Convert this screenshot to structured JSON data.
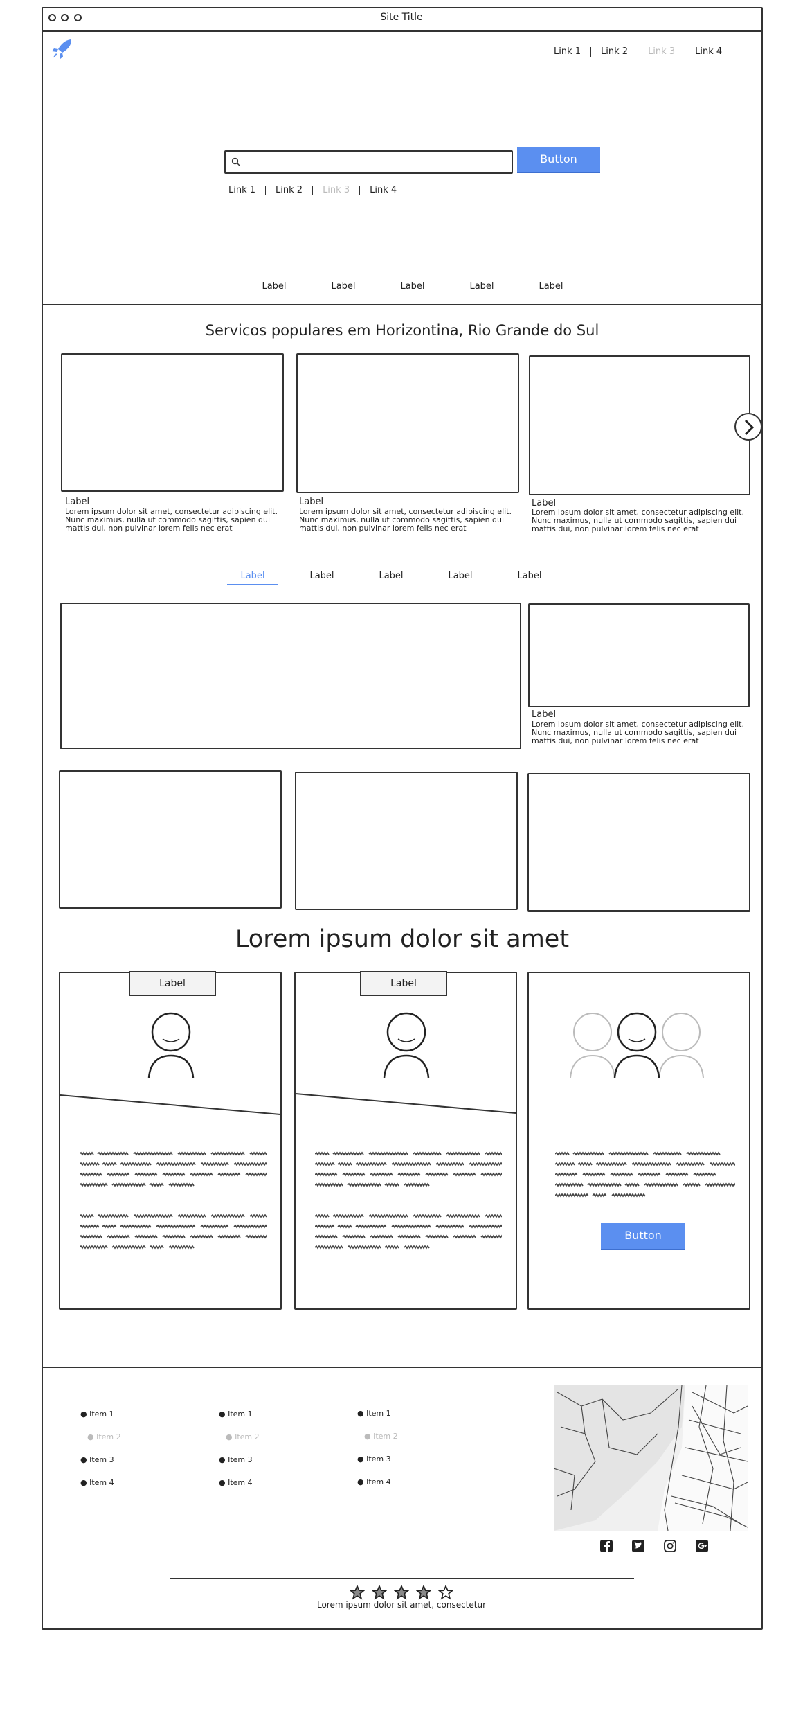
{
  "window": {
    "title": "Site Title"
  },
  "header": {
    "logo_icon": "rocket-icon",
    "nav": [
      {
        "label": "Link 1",
        "disabled": false
      },
      {
        "label": "Link 2",
        "disabled": false
      },
      {
        "label": "Link 3",
        "disabled": true
      },
      {
        "label": "Link 4",
        "disabled": false
      }
    ]
  },
  "hero": {
    "search": {
      "placeholder": "",
      "value": "",
      "icon": "search-icon"
    },
    "button_label": "Button",
    "links": [
      {
        "label": "Link 1",
        "disabled": false
      },
      {
        "label": "Link 2",
        "disabled": false
      },
      {
        "label": "Link 3",
        "disabled": true
      },
      {
        "label": "Link 4",
        "disabled": false
      }
    ],
    "tabs": [
      "Label",
      "Label",
      "Label",
      "Label",
      "Label"
    ]
  },
  "popular": {
    "title": "Servicos populares em Horizontina, Rio Grande do Sul",
    "cards": [
      {
        "label": "Label",
        "text": "Lorem ipsum dolor sit amet, consectetur adipiscing elit. Nunc maximus, nulla ut commodo sagittis, sapien dui mattis dui, non pulvinar lorem felis nec erat"
      },
      {
        "label": "Label",
        "text": "Lorem ipsum dolor sit amet, consectetur adipiscing elit. Nunc maximus, nulla ut commodo sagittis, sapien dui mattis dui, non pulvinar lorem felis nec erat"
      },
      {
        "label": "Label",
        "text": "Lorem ipsum dolor sit amet, consectetur adipiscing elit. Nunc maximus, nulla ut commodo sagittis, sapien dui mattis dui, non pulvinar lorem felis nec erat"
      }
    ]
  },
  "tabs2": {
    "items": [
      "Label",
      "Label",
      "Label",
      "Label",
      "Label"
    ],
    "active_index": 0,
    "side_card": {
      "label": "Label",
      "text": "Lorem ipsum dolor sit amet, consectetur adipiscing elit. Nunc maximus, nulla ut commodo sagittis, sapien dui mattis dui, non pulvinar lorem felis nec erat"
    }
  },
  "team": {
    "title": "Lorem ipsum dolor sit amet",
    "cards": [
      {
        "badge": "Label"
      },
      {
        "badge": "Label"
      },
      {
        "button_label": "Button"
      }
    ]
  },
  "footer": {
    "lists": [
      [
        {
          "label": "Item 1",
          "disabled": false
        },
        {
          "label": "Item 2",
          "disabled": true
        },
        {
          "label": "Item 3",
          "disabled": false
        },
        {
          "label": "Item 4",
          "disabled": false
        }
      ],
      [
        {
          "label": "Item 1",
          "disabled": false
        },
        {
          "label": "Item 2",
          "disabled": true
        },
        {
          "label": "Item 3",
          "disabled": false
        },
        {
          "label": "Item 4",
          "disabled": false
        }
      ],
      [
        {
          "label": "Item 1",
          "disabled": false
        },
        {
          "label": "Item 2",
          "disabled": true
        },
        {
          "label": "Item 3",
          "disabled": false
        },
        {
          "label": "Item 4",
          "disabled": false
        }
      ]
    ],
    "social_icons": [
      "facebook-icon",
      "twitter-icon",
      "instagram-icon",
      "google-plus-icon"
    ],
    "rating": {
      "stars": 5,
      "filled": 4
    },
    "copyright": "Lorem ipsum dolor sit amet, consectetur"
  },
  "colors": {
    "accent": "#5b8ff0",
    "stroke": "#333333",
    "disabled": "#bbbbbb"
  }
}
